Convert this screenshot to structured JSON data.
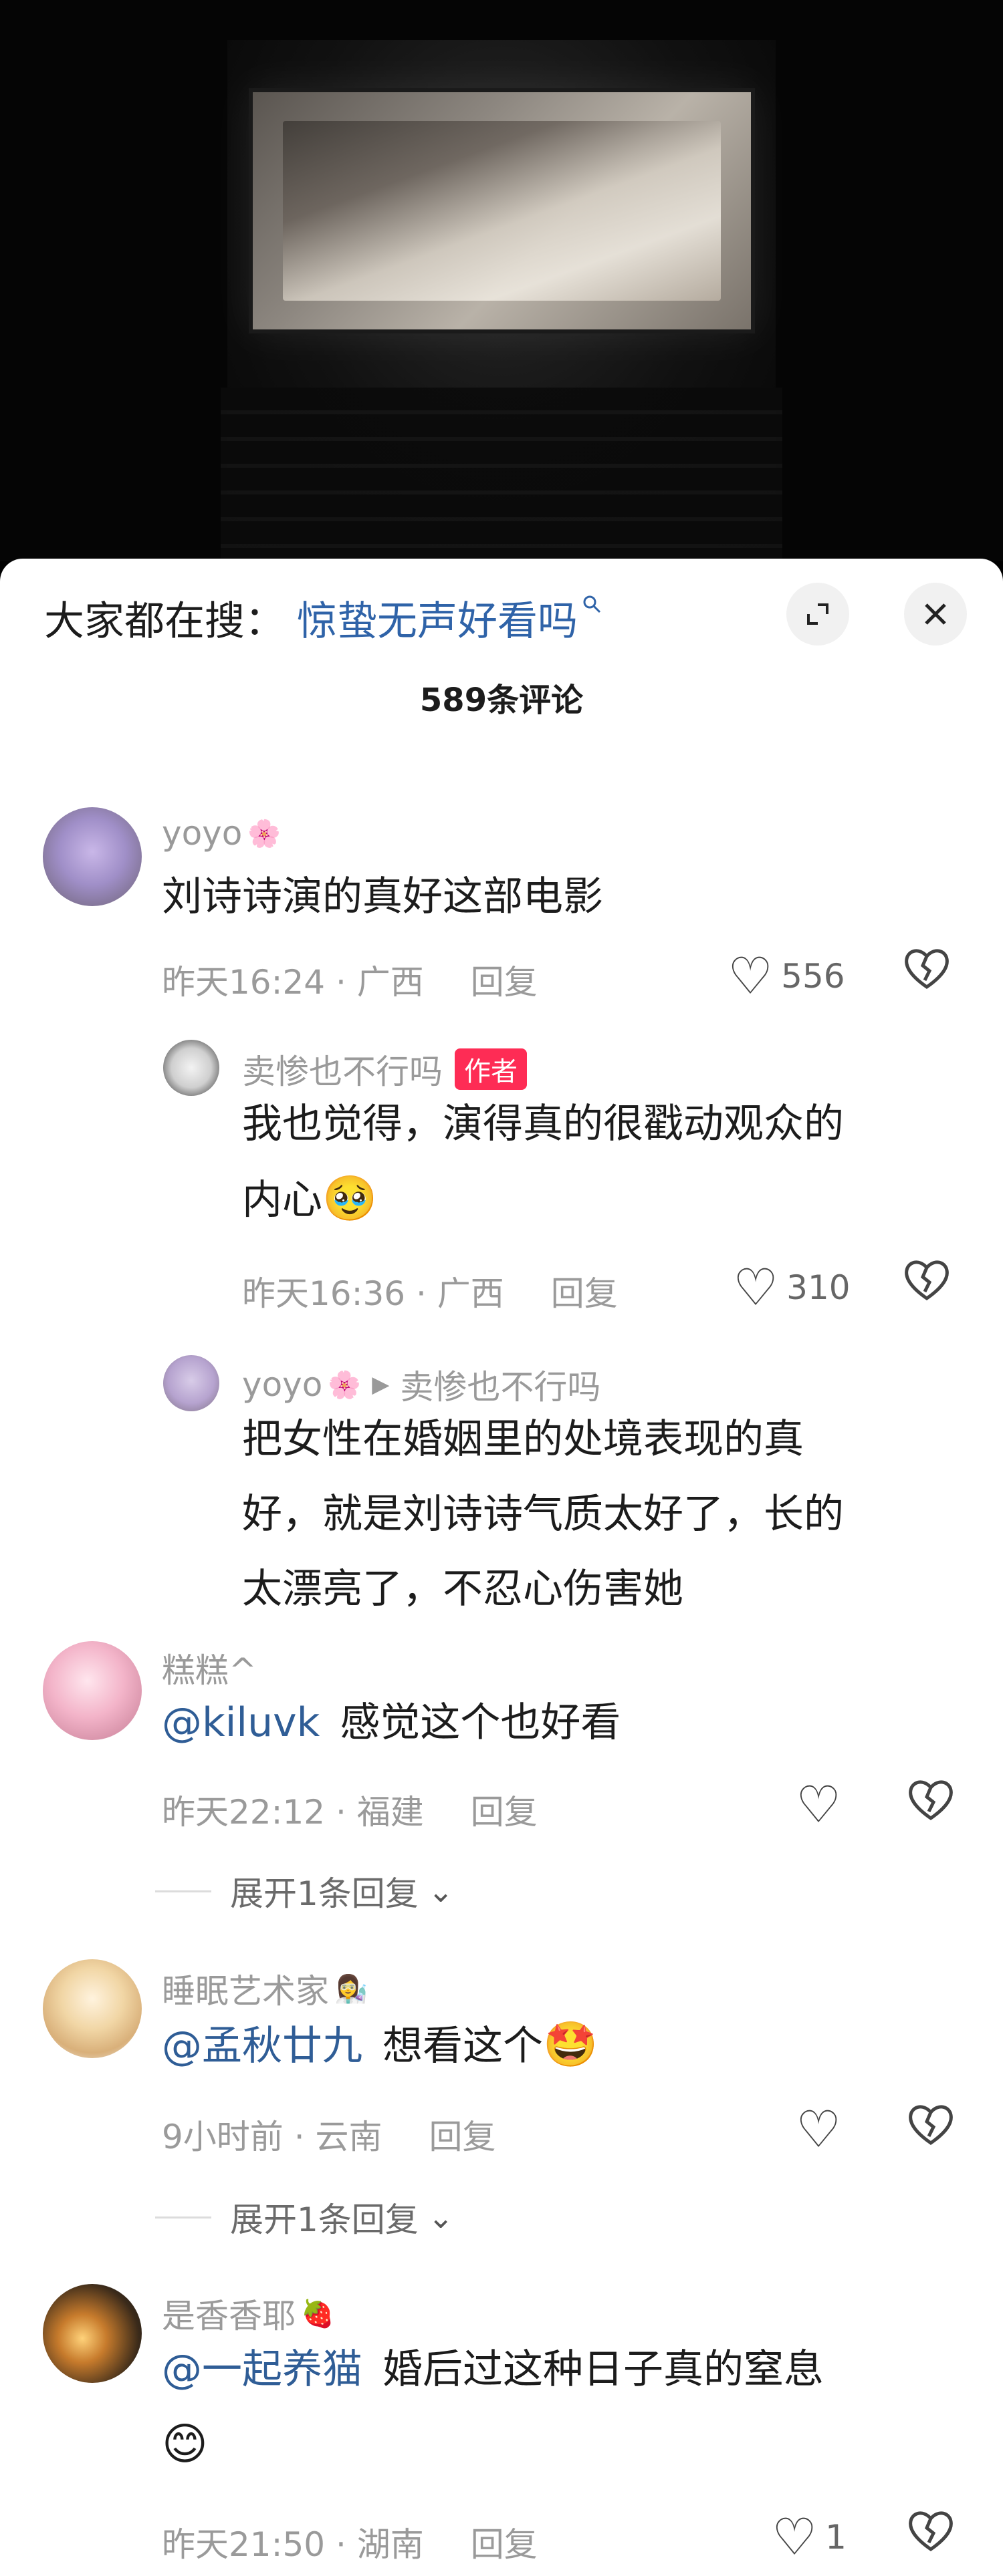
{
  "search": {
    "prefix": "大家都在搜：",
    "keyword": "惊蛰无声好看吗",
    "search_icon": "search-icon"
  },
  "header": {
    "expand_icon": "expand-icon",
    "close_icon": "close-icon",
    "comment_count": "589条评论"
  },
  "comments": [
    {
      "username": "yoyo",
      "username_emoji": "🌸",
      "text": "刘诗诗演的真好这部电影",
      "time_location": "昨天16:24 · 广西",
      "reply_label": "回复",
      "likes": "556",
      "replies": [
        {
          "username": "卖惨也不行吗",
          "author_tag": "作者",
          "text_line1": "我也觉得，演得真的很戳动观众的",
          "text_line2": "内心",
          "text_emoji": "🥹",
          "time_location": "昨天16:36 · 广西",
          "reply_label": "回复",
          "likes": "310"
        },
        {
          "username": "yoyo",
          "username_emoji": "🌸",
          "reply_to": "卖惨也不行吗",
          "text_line1": "把女性在婚姻里的处境表现的真",
          "text_line2": "好，就是刘诗诗气质太好了，长的",
          "text_line3": "太漂亮了，不忍心伤害她"
        }
      ]
    },
    {
      "username": "糕糕^",
      "mention": "@kiluvk",
      "text": "感觉这个也好看",
      "time_location": "昨天22:12 · 福建",
      "reply_label": "回复",
      "expand_label": "展开1条回复"
    },
    {
      "username": "睡眠艺术家",
      "username_emoji": "👩‍🔬",
      "mention": "@孟秋廿九",
      "text": "想看这个",
      "text_emoji": "🤩",
      "time_location": "9小时前 · 云南",
      "reply_label": "回复",
      "expand_label": "展开1条回复"
    },
    {
      "username": "是香香耶",
      "username_emoji": "🍓",
      "mention": "@一起养猫",
      "text": "婚后过这种日子真的窒息",
      "text_emoji": "😊",
      "time_location": "昨天21:50 · 湖南",
      "reply_label": "回复",
      "likes": "1"
    }
  ],
  "icons": {
    "like": "heart-icon",
    "dislike": "broken-heart-icon",
    "chevron": "chevron-down-icon"
  }
}
